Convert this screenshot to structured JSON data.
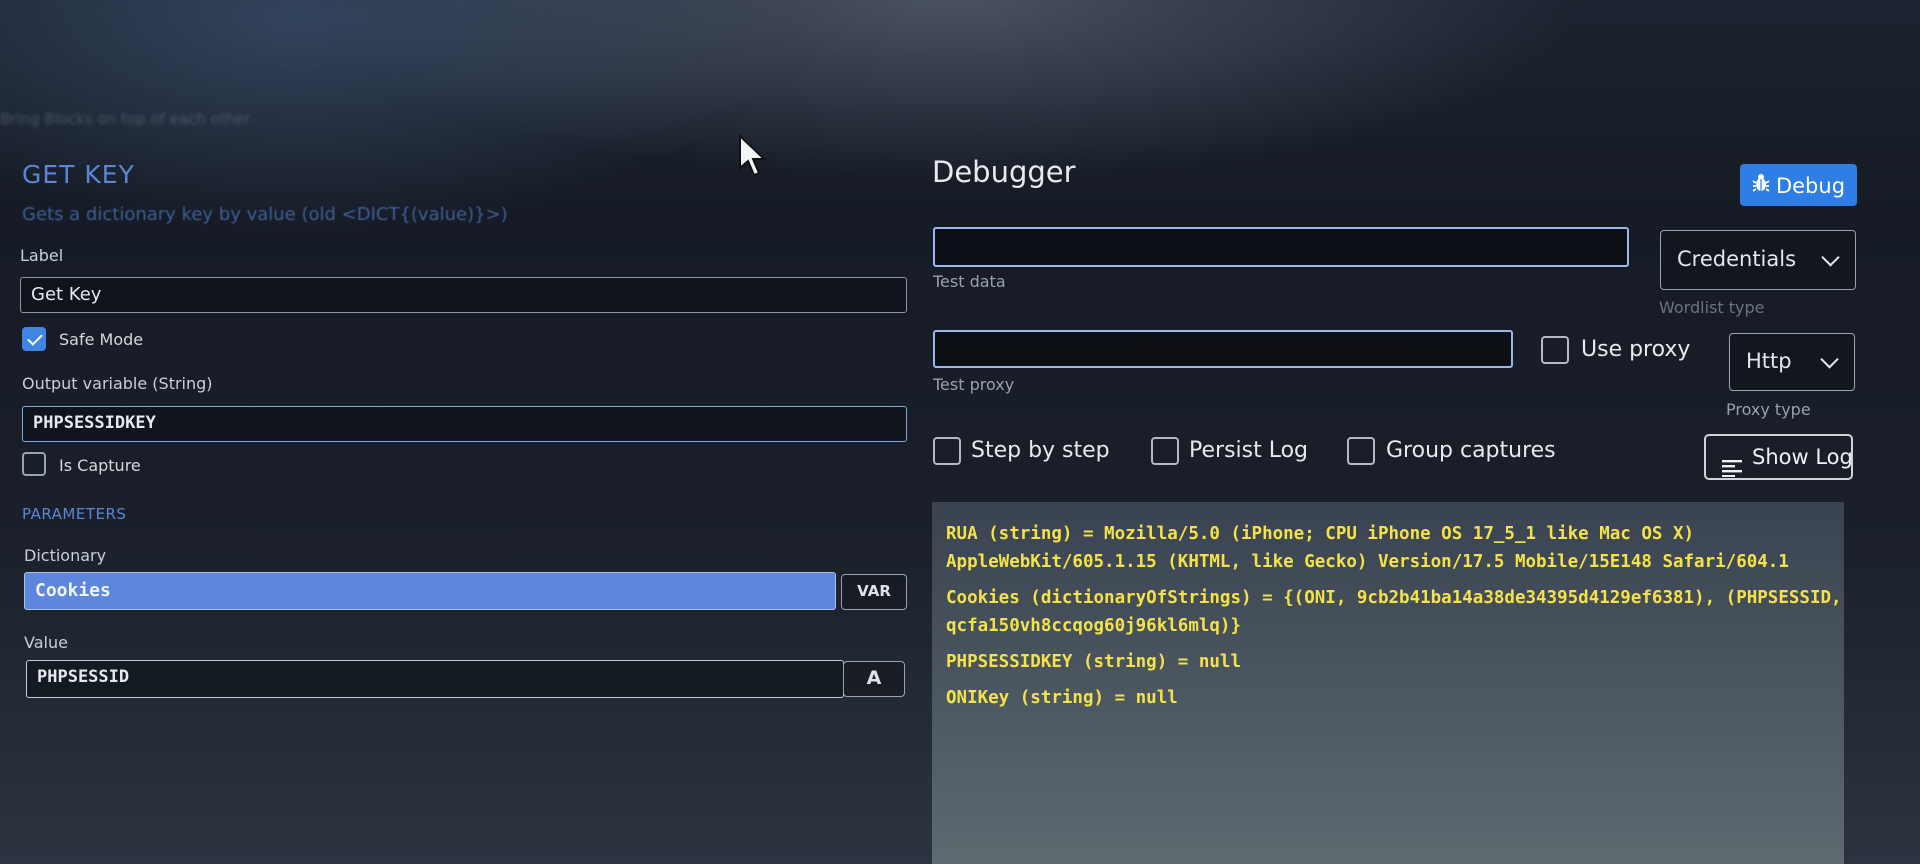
{
  "breadcrumb": "Bring Blocks on top of each other",
  "block": {
    "title": "GET KEY",
    "description": "Gets a dictionary key by value (old <DICT{(value)}>)",
    "label_caption": "Label",
    "label_value": "Get Key",
    "safe_mode_label": "Safe Mode",
    "safe_mode_checked": true,
    "output_caption": "Output variable (String)",
    "output_value": "PHPSESSIDKEY",
    "is_capture_label": "Is Capture",
    "parameters_header": "PARAMETERS",
    "dictionary_caption": "Dictionary",
    "dictionary_value": "Cookies",
    "var_button": "VAR",
    "value_caption": "Value",
    "value_value": "PHPSESSID",
    "value_mode_icon": "A"
  },
  "debugger": {
    "title": "Debugger",
    "debug_button": "Debug",
    "debug_icon": "bug-icon",
    "test_data_value": "",
    "test_data_hint": "Test data",
    "wordlist_type_value": "Credentials",
    "wordlist_type_hint": "Wordlist type",
    "test_proxy_value": "",
    "test_proxy_hint": "Test proxy",
    "use_proxy_label": "Use proxy",
    "proxy_type_value": "Http",
    "proxy_type_hint": "Proxy type",
    "step_by_step_label": "Step by step",
    "persist_log_label": "Persist Log",
    "group_captures_label": "Group captures",
    "show_log_button": "Show Log",
    "log_lines": [
      "RUA (string) = Mozilla/5.0 (iPhone; CPU iPhone OS 17_5_1 like Mac OS X) AppleWebKit/605.1.15 (KHTML, like Gecko) Version/17.5 Mobile/15E148 Safari/604.1",
      "Cookies (dictionaryOfStrings) = {(ONI, 9cb2b41ba14a38de34395d4129ef6381), (PHPSESSID, qcfa150vh8ccqog60j96kl6mlq)}",
      "PHPSESSIDKEY (string) = null",
      "ONIKey (string) = null"
    ]
  },
  "colors": {
    "accent": "#3f86e3",
    "log_text": "#f3e24a",
    "title_blue": "#5b86d6"
  }
}
